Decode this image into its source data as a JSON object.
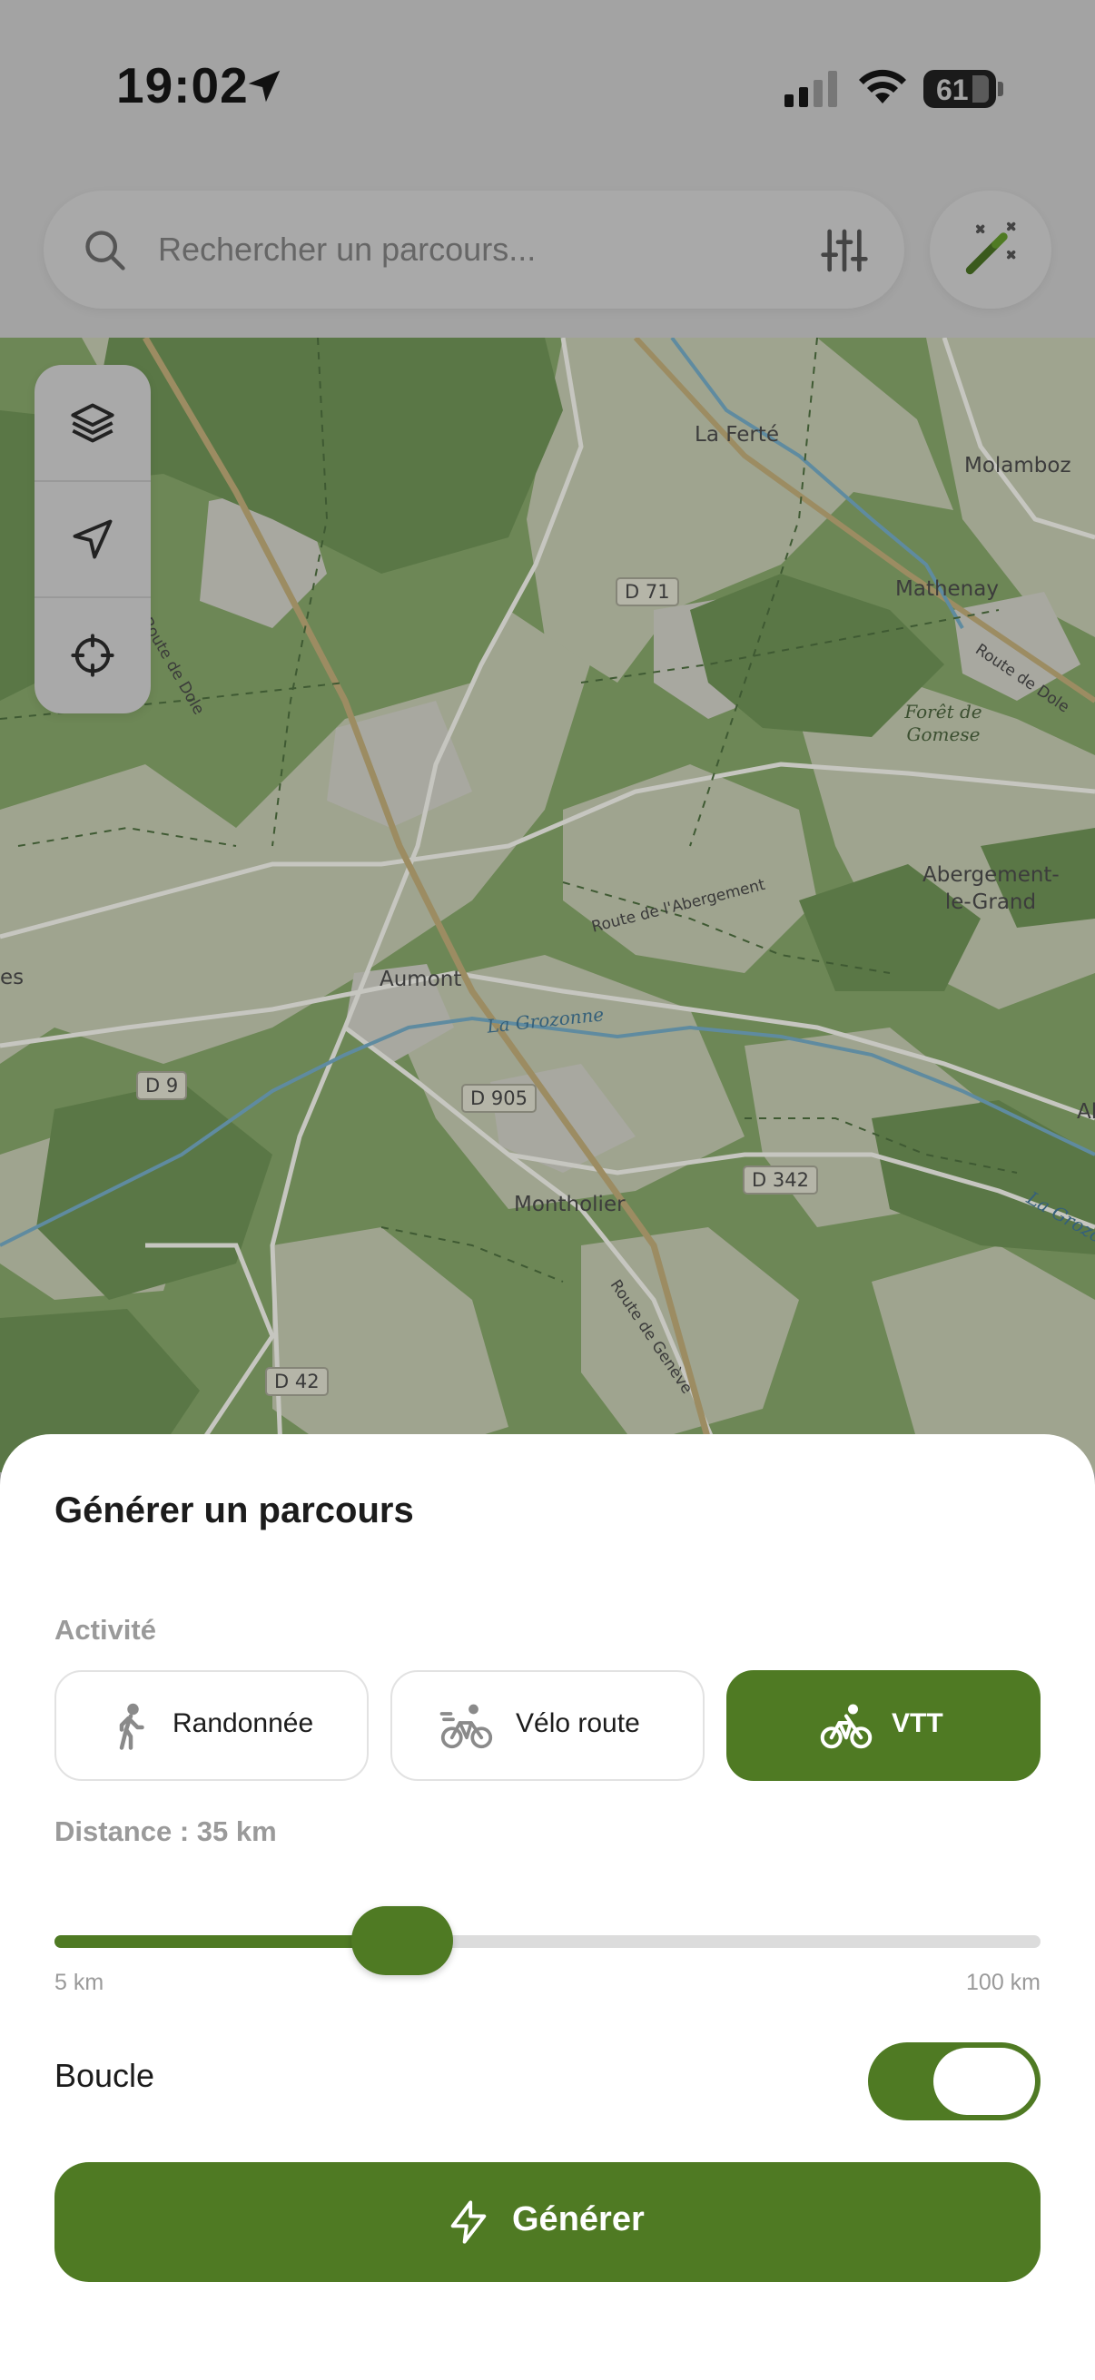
{
  "status_bar": {
    "time": "19:02",
    "battery": "61",
    "icons": [
      "location-arrow-icon",
      "cellular-signal-icon",
      "wifi-icon",
      "battery-icon"
    ]
  },
  "search": {
    "placeholder": "Rechercher un parcours...",
    "icons": [
      "search-icon",
      "filter-sliders-icon",
      "magic-wand-icon"
    ]
  },
  "map": {
    "places": [
      "La Ferté",
      "Molamboz",
      "Mathenay",
      "Abergement-le-Grand",
      "Aumont",
      "Montholier",
      "es",
      "Al"
    ],
    "roads": [
      "D 71",
      "D 9",
      "D 905",
      "D 342",
      "D 42"
    ],
    "road_names": [
      "Route de Dole",
      "Route de Dole",
      "Route de l'Abergement",
      "Route de Genève"
    ],
    "forest": "Forêt de Gomese",
    "rivers": [
      "La Grozonne",
      "La Grozon"
    ],
    "controls": [
      "layers-icon",
      "navigation-arrow-icon",
      "crosshair-icon"
    ]
  },
  "sheet": {
    "title": "Générer un parcours",
    "activity_label": "Activité",
    "activities": [
      {
        "label": "Randonnée",
        "icon": "hiker-icon",
        "selected": false
      },
      {
        "label": "Vélo route",
        "icon": "road-bike-icon",
        "selected": false
      },
      {
        "label": "VTT",
        "icon": "mountain-bike-icon",
        "selected": true
      }
    ],
    "distance_label": "Distance : 35 km",
    "distance": {
      "min": 5,
      "max": 100,
      "value": 35
    },
    "min_label": "5 km",
    "max_label": "100 km",
    "loop_label": "Boucle",
    "loop_enabled": true,
    "generate_label": "Générer",
    "accent_color": "#4f7a23"
  }
}
